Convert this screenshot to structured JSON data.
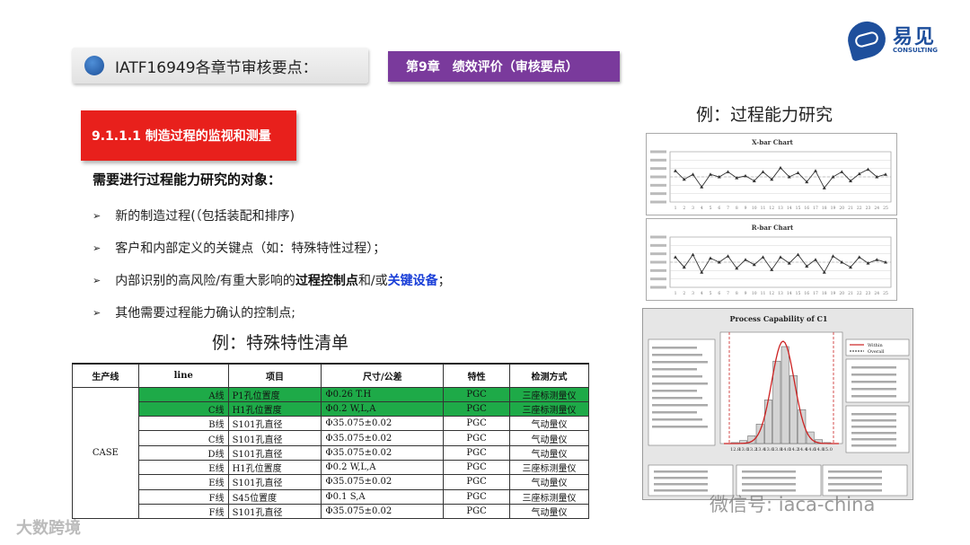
{
  "header": {
    "title": "IATF16949各章节审核要点：",
    "chapter": "第9章　绩效评价（审核要点）",
    "logo_cn": "易见",
    "logo_en": "CONSULTING"
  },
  "section": {
    "label": "9.1.1.1 制造过程的监视和测量",
    "subhead": "需要进行过程能力研究的对象：",
    "bullets": [
      {
        "text": "新的制造过程(（包括装配和排序)"
      },
      {
        "text": "客户和内部定义的关键点（如：特殊特性过程）；"
      },
      {
        "pre": "内部识别的高风险/有重大影响的",
        "b1": "过程控制点",
        "mid": "和/或",
        "b2": "关键设备",
        "post": "；"
      },
      {
        "text": "其他需要过程能力确认的控制点;"
      }
    ]
  },
  "table": {
    "title": "例：特殊特性清单",
    "headers": [
      "生产线",
      "line",
      "项目",
      "尺寸/公差",
      "特性",
      "检测方式"
    ],
    "group": "CASE",
    "rows": [
      {
        "line": "A线",
        "item": "P1孔位置度",
        "dim": "Φ0.26 T.H",
        "char": "PGC",
        "method": "三座标测量仪",
        "hl": true
      },
      {
        "line": "C线",
        "item": "H1孔位置度",
        "dim": "Φ0.2 W,L,A",
        "char": "PGC",
        "method": "三座标测量仪",
        "hl": true
      },
      {
        "line": "B线",
        "item": "S101孔直径",
        "dim": "Φ35.075±0.02",
        "char": "PGC",
        "method": "气动量仪",
        "hl": false
      },
      {
        "line": "C线",
        "item": "S101孔直径",
        "dim": "Φ35.075±0.02",
        "char": "PGC",
        "method": "气动量仪",
        "hl": false
      },
      {
        "line": "D线",
        "item": "S101孔直径",
        "dim": "Φ35.075±0.02",
        "char": "PGC",
        "method": "气动量仪",
        "hl": false
      },
      {
        "line": "E线",
        "item": "H1孔位置度",
        "dim": "Φ0.2 W,L,A",
        "char": "PGC",
        "method": "三座标测量仪",
        "hl": false
      },
      {
        "line": "E线",
        "item": "S101孔直径",
        "dim": "Φ35.075±0.02",
        "char": "PGC",
        "method": "气动量仪",
        "hl": false
      },
      {
        "line": "F线",
        "item": "S45位置度",
        "dim": "Φ0.1 S,A",
        "char": "PGC",
        "method": "三座标测量仪",
        "hl": false
      },
      {
        "line": "F线",
        "item": "S101孔直径",
        "dim": "Φ35.075±0.02",
        "char": "PGC",
        "method": "气动量仪",
        "hl": false
      }
    ]
  },
  "charts": {
    "title": "例：过程能力研究",
    "xbar_title": "X-bar Chart",
    "rbar_title": "R-bar Chart",
    "pcap_title": "Process Capability of C1"
  },
  "chart_data": [
    {
      "type": "line",
      "title": "X-bar Chart",
      "x": [
        1,
        2,
        3,
        4,
        5,
        6,
        7,
        8,
        9,
        10,
        11,
        12,
        13,
        14,
        15,
        16,
        17,
        18,
        19,
        20,
        21,
        22,
        23,
        24,
        25
      ],
      "series": [
        {
          "values": [
            0.62,
            0.45,
            0.55,
            0.3,
            0.55,
            0.5,
            0.6,
            0.48,
            0.52,
            0.42,
            0.6,
            0.45,
            0.68,
            0.5,
            0.58,
            0.4,
            0.62,
            0.28,
            0.5,
            0.6,
            0.42,
            0.56,
            0.65,
            0.5,
            0.55
          ]
        }
      ]
    },
    {
      "type": "line",
      "title": "R-bar Chart",
      "x": [
        1,
        2,
        3,
        4,
        5,
        6,
        7,
        8,
        9,
        10,
        11,
        12,
        13,
        14,
        15,
        16,
        17,
        18,
        19,
        20,
        21,
        22,
        23,
        24,
        25
      ],
      "series": [
        {
          "values": [
            0.6,
            0.4,
            0.65,
            0.3,
            0.58,
            0.5,
            0.62,
            0.38,
            0.55,
            0.45,
            0.6,
            0.35,
            0.6,
            0.48,
            0.65,
            0.42,
            0.55,
            0.3,
            0.62,
            0.5,
            0.4,
            0.6,
            0.48,
            0.55,
            0.5
          ]
        }
      ]
    },
    {
      "type": "bar",
      "title": "Process Capability of C1",
      "categories": [
        "12.8",
        "13.0",
        "13.2",
        "13.4",
        "13.6",
        "13.8",
        "14.0",
        "14.2",
        "14.4",
        "14.6",
        "14.8",
        "15.0"
      ],
      "values": [
        0.01,
        0.03,
        0.08,
        0.2,
        0.45,
        0.85,
        1.0,
        0.7,
        0.35,
        0.12,
        0.04,
        0.01
      ],
      "series": [
        {
          "name": "Within"
        },
        {
          "name": "Overall"
        }
      ]
    }
  ],
  "watermarks": {
    "wechat": "微信号: iaca-china",
    "bottom": "大数跨境"
  }
}
